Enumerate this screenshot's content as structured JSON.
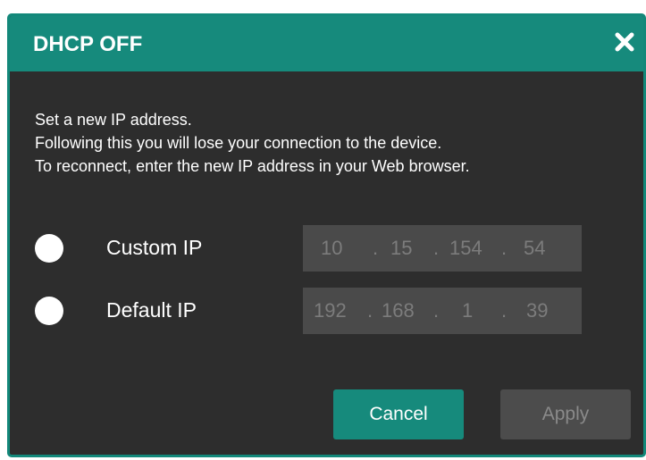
{
  "dialog": {
    "title": "DHCP OFF",
    "close_icon": "close-icon",
    "message_lines": [
      "Set a new IP address.",
      "Following this you will lose your connection to the device.",
      "To reconnect, enter the new IP address in your Web browser."
    ],
    "options": [
      {
        "label": "Custom IP",
        "octets": [
          "10",
          "15",
          "154",
          "54"
        ]
      },
      {
        "label": "Default IP",
        "octets": [
          "192",
          "168",
          "1",
          "39"
        ]
      }
    ],
    "ip_separator": ".",
    "buttons": {
      "cancel": "Cancel",
      "apply": "Apply"
    }
  },
  "colors": {
    "accent": "#168a7c",
    "dialog_bg": "#2d2d2d",
    "field_bg": "#4a4a4a",
    "disabled_text": "#7c7c7c"
  }
}
